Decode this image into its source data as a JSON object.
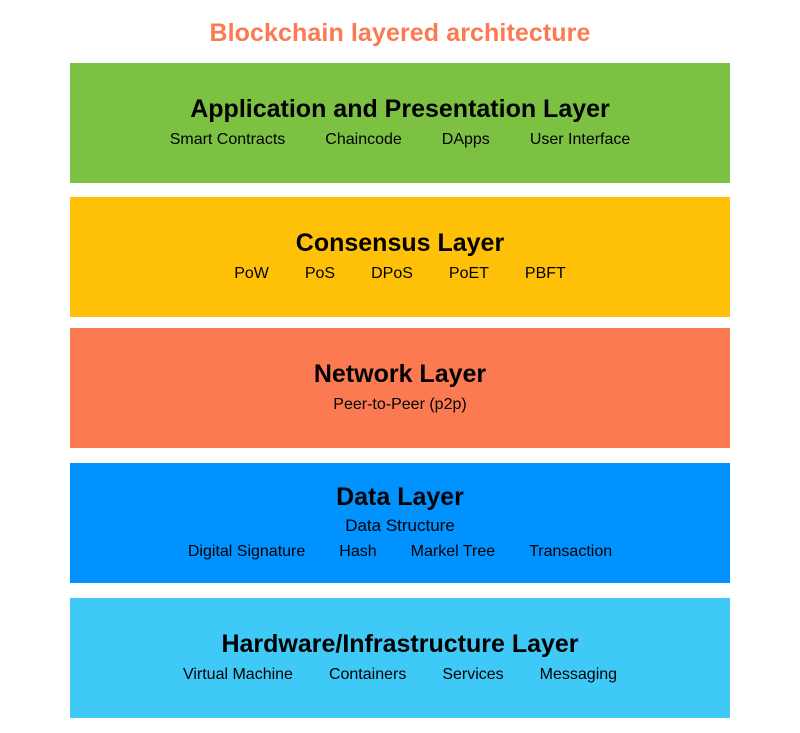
{
  "title": "Blockchain layered architecture",
  "colors": {
    "background": "#ffffff",
    "title": "#FB7A52",
    "text": "#000000",
    "application_layer": "#7CC142",
    "consensus_layer": "#FFC107",
    "network_layer": "#FB7A52",
    "data_layer": "#0093FF",
    "hardware_layer": "#3FC9F7"
  },
  "chart_data": {
    "type": "diagram",
    "subtype": "layered-stack",
    "title": "Blockchain layered architecture",
    "orientation": "vertical-top-to-bottom",
    "layer_count": 5,
    "layers": [
      {
        "index": 0,
        "name": "Application and Presentation Layer",
        "subtitle": "",
        "color": "#7CC142",
        "items": [
          "Smart Contracts",
          "Chaincode",
          "DApps",
          "User Interface"
        ]
      },
      {
        "index": 1,
        "name": "Consensus Layer",
        "subtitle": "",
        "color": "#FFC107",
        "items": [
          "PoW",
          "PoS",
          "DPoS",
          "PoET",
          "PBFT"
        ]
      },
      {
        "index": 2,
        "name": "Network Layer",
        "subtitle": "",
        "color": "#FB7A52",
        "items": [
          "Peer-to-Peer (p2p)"
        ]
      },
      {
        "index": 3,
        "name": "Data Layer",
        "subtitle": "Data Structure",
        "color": "#0093FF",
        "items": [
          "Digital Signature",
          "Hash",
          "Markel Tree",
          "Transaction"
        ]
      },
      {
        "index": 4,
        "name": "Hardware/Infrastructure Layer",
        "subtitle": "",
        "color": "#3FC9F7",
        "items": [
          "Virtual Machine",
          "Containers",
          "Services",
          "Messaging"
        ]
      }
    ]
  }
}
